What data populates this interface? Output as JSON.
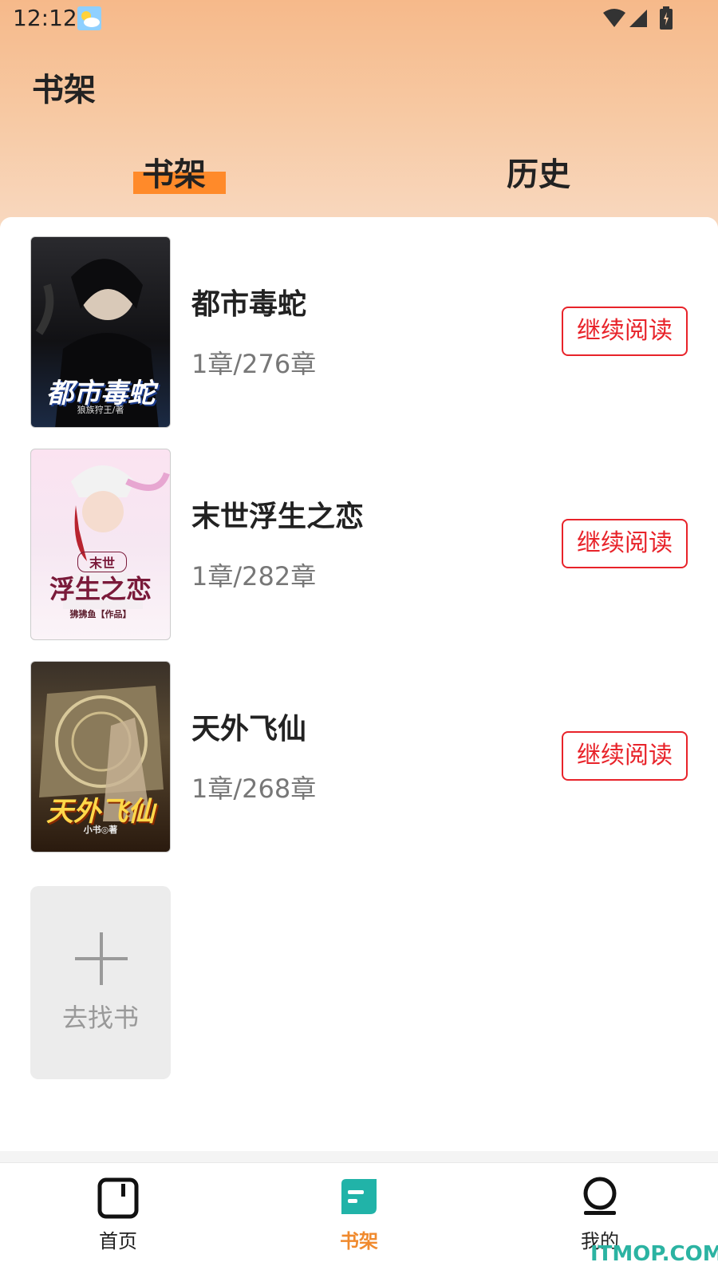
{
  "status_bar": {
    "time": "12:12"
  },
  "header": {
    "title": "书架"
  },
  "tabs": [
    {
      "label": "书架",
      "active": true
    },
    {
      "label": "历史",
      "active": false
    }
  ],
  "books": [
    {
      "title": "都市毒蛇",
      "progress": "1章/276章",
      "action": "继续阅读",
      "cover_title": "都市毒蛇",
      "cover_author": "狼族狩王/著"
    },
    {
      "title": "末世浮生之恋",
      "progress": "1章/282章",
      "action": "继续阅读",
      "cover_title": "浮生之恋",
      "cover_tag": "末世",
      "cover_author": "狒狒鱼【作品】"
    },
    {
      "title": "天外飞仙",
      "progress": "1章/268章",
      "action": "继续阅读",
      "cover_title": "天外飞仙",
      "cover_author": "小书◎著"
    }
  ],
  "find_book": {
    "label": "去找书"
  },
  "bottom_nav": [
    {
      "label": "首页",
      "icon": "home-icon"
    },
    {
      "label": "书架",
      "icon": "bookshelf-icon",
      "active": true
    },
    {
      "label": "我的",
      "icon": "profile-icon"
    }
  ],
  "watermark": "ITMOP.COM",
  "colors": {
    "accent_orange": "#ff8a2a",
    "button_red": "#e8232a",
    "nav_teal": "#21b3a8",
    "nav_active_label": "#f08a2e"
  }
}
